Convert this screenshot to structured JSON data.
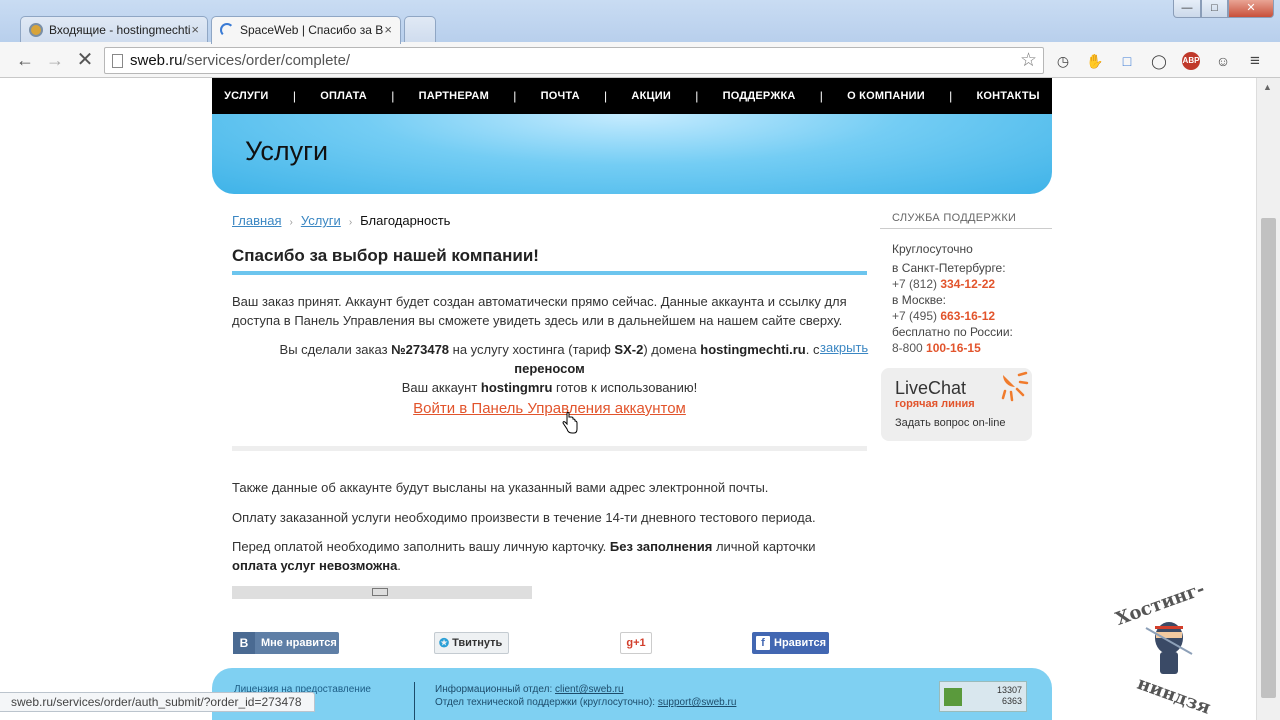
{
  "browser": {
    "tabs": [
      {
        "title": "Входящие - hostingmechti",
        "close": "×"
      },
      {
        "title": "SpaceWeb | Спасибо за В",
        "close": "×"
      }
    ],
    "window_buttons": {
      "minimize": "—",
      "maximize": "□",
      "close": "✕"
    },
    "address": {
      "host": "sweb.ru",
      "path": "/services/order/complete/"
    },
    "extensions": {
      "abp_label": "ABP",
      "abp_badge": "2"
    },
    "status_url": "sweb.ru/services/order/auth_submit/?order_id=273478"
  },
  "site": {
    "nav": [
      "УСЛУГИ",
      "ОПЛАТА",
      "ПАРТНЕРАМ",
      "ПОЧТА",
      "АКЦИИ",
      "ПОДДЕРЖКА",
      "О КОМПАНИИ",
      "КОНТАКТЫ"
    ],
    "nav_separator": "|",
    "banner_title": "Услуги",
    "breadcrumb": {
      "home": "Главная",
      "services": "Услуги",
      "current": "Благодарность",
      "arrow": "›"
    },
    "heading": "Спасибо за выбор нашей компании!",
    "intro": "Ваш заказ принят. Аккаунт будет создан автоматически прямо сейчас. Данные аккаунта и ссылку для доступа в Панель Управления вы сможете увидеть здесь или в дальнейшем на нашем сайте сверху.",
    "order": {
      "t1": "Вы сделали заказ ",
      "number": "№273478",
      "t2": " на услугу хостинга (тариф ",
      "tariff": "SX-2",
      "t3": ") домена ",
      "domain": "hostingmechti.ru",
      "t4": ". с ",
      "transfer": "переносом",
      "t5": "Ваш аккаунт ",
      "account": "hostingmru",
      "t6": " готов к использованию!"
    },
    "close_link": "закрыть",
    "panel_link": "Войти в Панель Управления аккаунтом",
    "email_note": "Также данные об аккаунте будут высланы на указанный вами адрес электронной почты.",
    "payment_note": "Оплату заказанной услуги необходимо произвести в течение 14-ти дневного тестового периода.",
    "card_note": {
      "t1": "Перед оплатой необходимо заполнить вашу личную карточку. ",
      "b1": "Без заполнения",
      "t2": " личной карточки ",
      "b2": "оплата услуг невозможна",
      "t3": "."
    },
    "share": {
      "vk_logo": "B",
      "vk": "Мне нравится",
      "tweet": "Твитнуть",
      "gplus": "g+1",
      "fb_logo": "f",
      "fb": "Нравится"
    },
    "footer": {
      "left": "Лицензия на предоставление",
      "info1_label": "Информационный отдел: ",
      "info1_email": "client@sweb.ru",
      "info2_label": "Отдел технической поддержки (круглосуточно): ",
      "info2_email": "support@sweb.ru",
      "counter_top": "13307",
      "counter_bottom": "6363"
    },
    "sidebar": {
      "title": "СЛУЖБА ПОДДЕРЖКИ",
      "line1": "Круглосуточно",
      "line2": "в Санкт-Петербурге:",
      "spb_code": "+7 (812) ",
      "spb_num": "334-12-22",
      "line3": "в Москве:",
      "msk_code": "+7 (495) ",
      "msk_num": "663-16-12",
      "line4": "бесплатно по России:",
      "ru_code": "8-800 ",
      "ru_num": "100-16-15",
      "livechat_title": "LiveChat",
      "livechat_sub": "горячая линия",
      "livechat_ask": "Задать вопрос on-line"
    }
  },
  "colors": {
    "accent_blue": "#6cc5ee",
    "link": "#3b87c3",
    "orange": "#e2542c",
    "nav_bg": "#000000"
  },
  "icons": [
    "mail-favicon",
    "loading-spinner-icon",
    "back-arrow-icon",
    "forward-arrow-icon",
    "stop-icon",
    "page-icon",
    "bookmark-star-icon",
    "history-icon",
    "shield-icon",
    "folder-icon",
    "circle-icon",
    "adblock-icon",
    "panda-icon",
    "menu-icon",
    "hand-cursor-icon",
    "livechat-sun-icon",
    "hosting-ninja-watermark"
  ]
}
